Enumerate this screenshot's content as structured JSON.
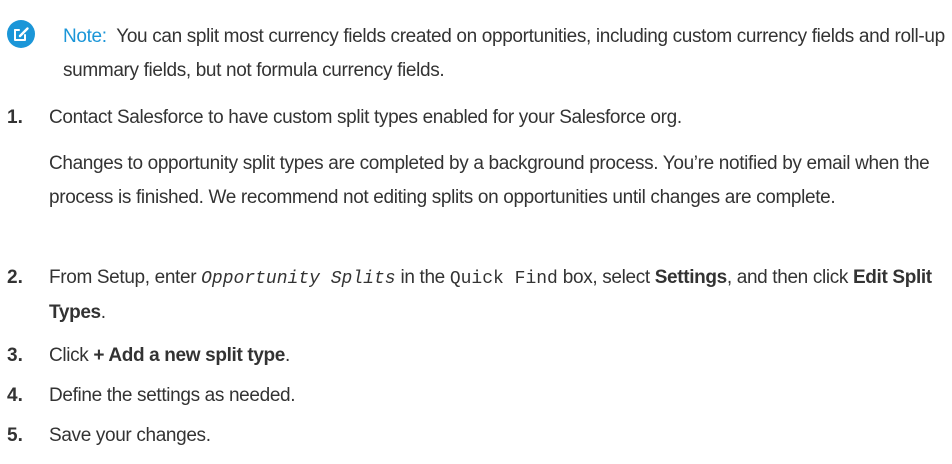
{
  "note": {
    "label": "Note:",
    "text": "You can split most currency fields created on opportunities, including custom currency fields and roll-up summary fields, but not formula currency fields."
  },
  "steps": [
    {
      "number": "1.",
      "text": "Contact Salesforce to have custom split types enabled for your Salesforce org.",
      "detail": "Changes to opportunity split types are completed by a background process. You’re notified by email when the process is finished. We recommend not editing splits on opportunities until changes are complete."
    },
    {
      "number": "2.",
      "prefix": "From Setup, enter",
      "code_italic": "Opportunity Splits",
      "middle": "in the",
      "code": "Quick Find",
      "middle2": "box, select",
      "bold1": "Settings",
      "middle3": ", and then click",
      "bold2": "Edit Split Types",
      "suffix": "."
    },
    {
      "number": "3.",
      "prefix": "Click",
      "bold": "+ Add a new split type",
      "suffix": "."
    },
    {
      "number": "4.",
      "text": "Define the settings as needed."
    },
    {
      "number": "5.",
      "text": "Save your changes."
    }
  ],
  "colors": {
    "accent": "#1b96d8",
    "text": "#333333"
  },
  "icons": {
    "note": "edit-note-icon"
  }
}
